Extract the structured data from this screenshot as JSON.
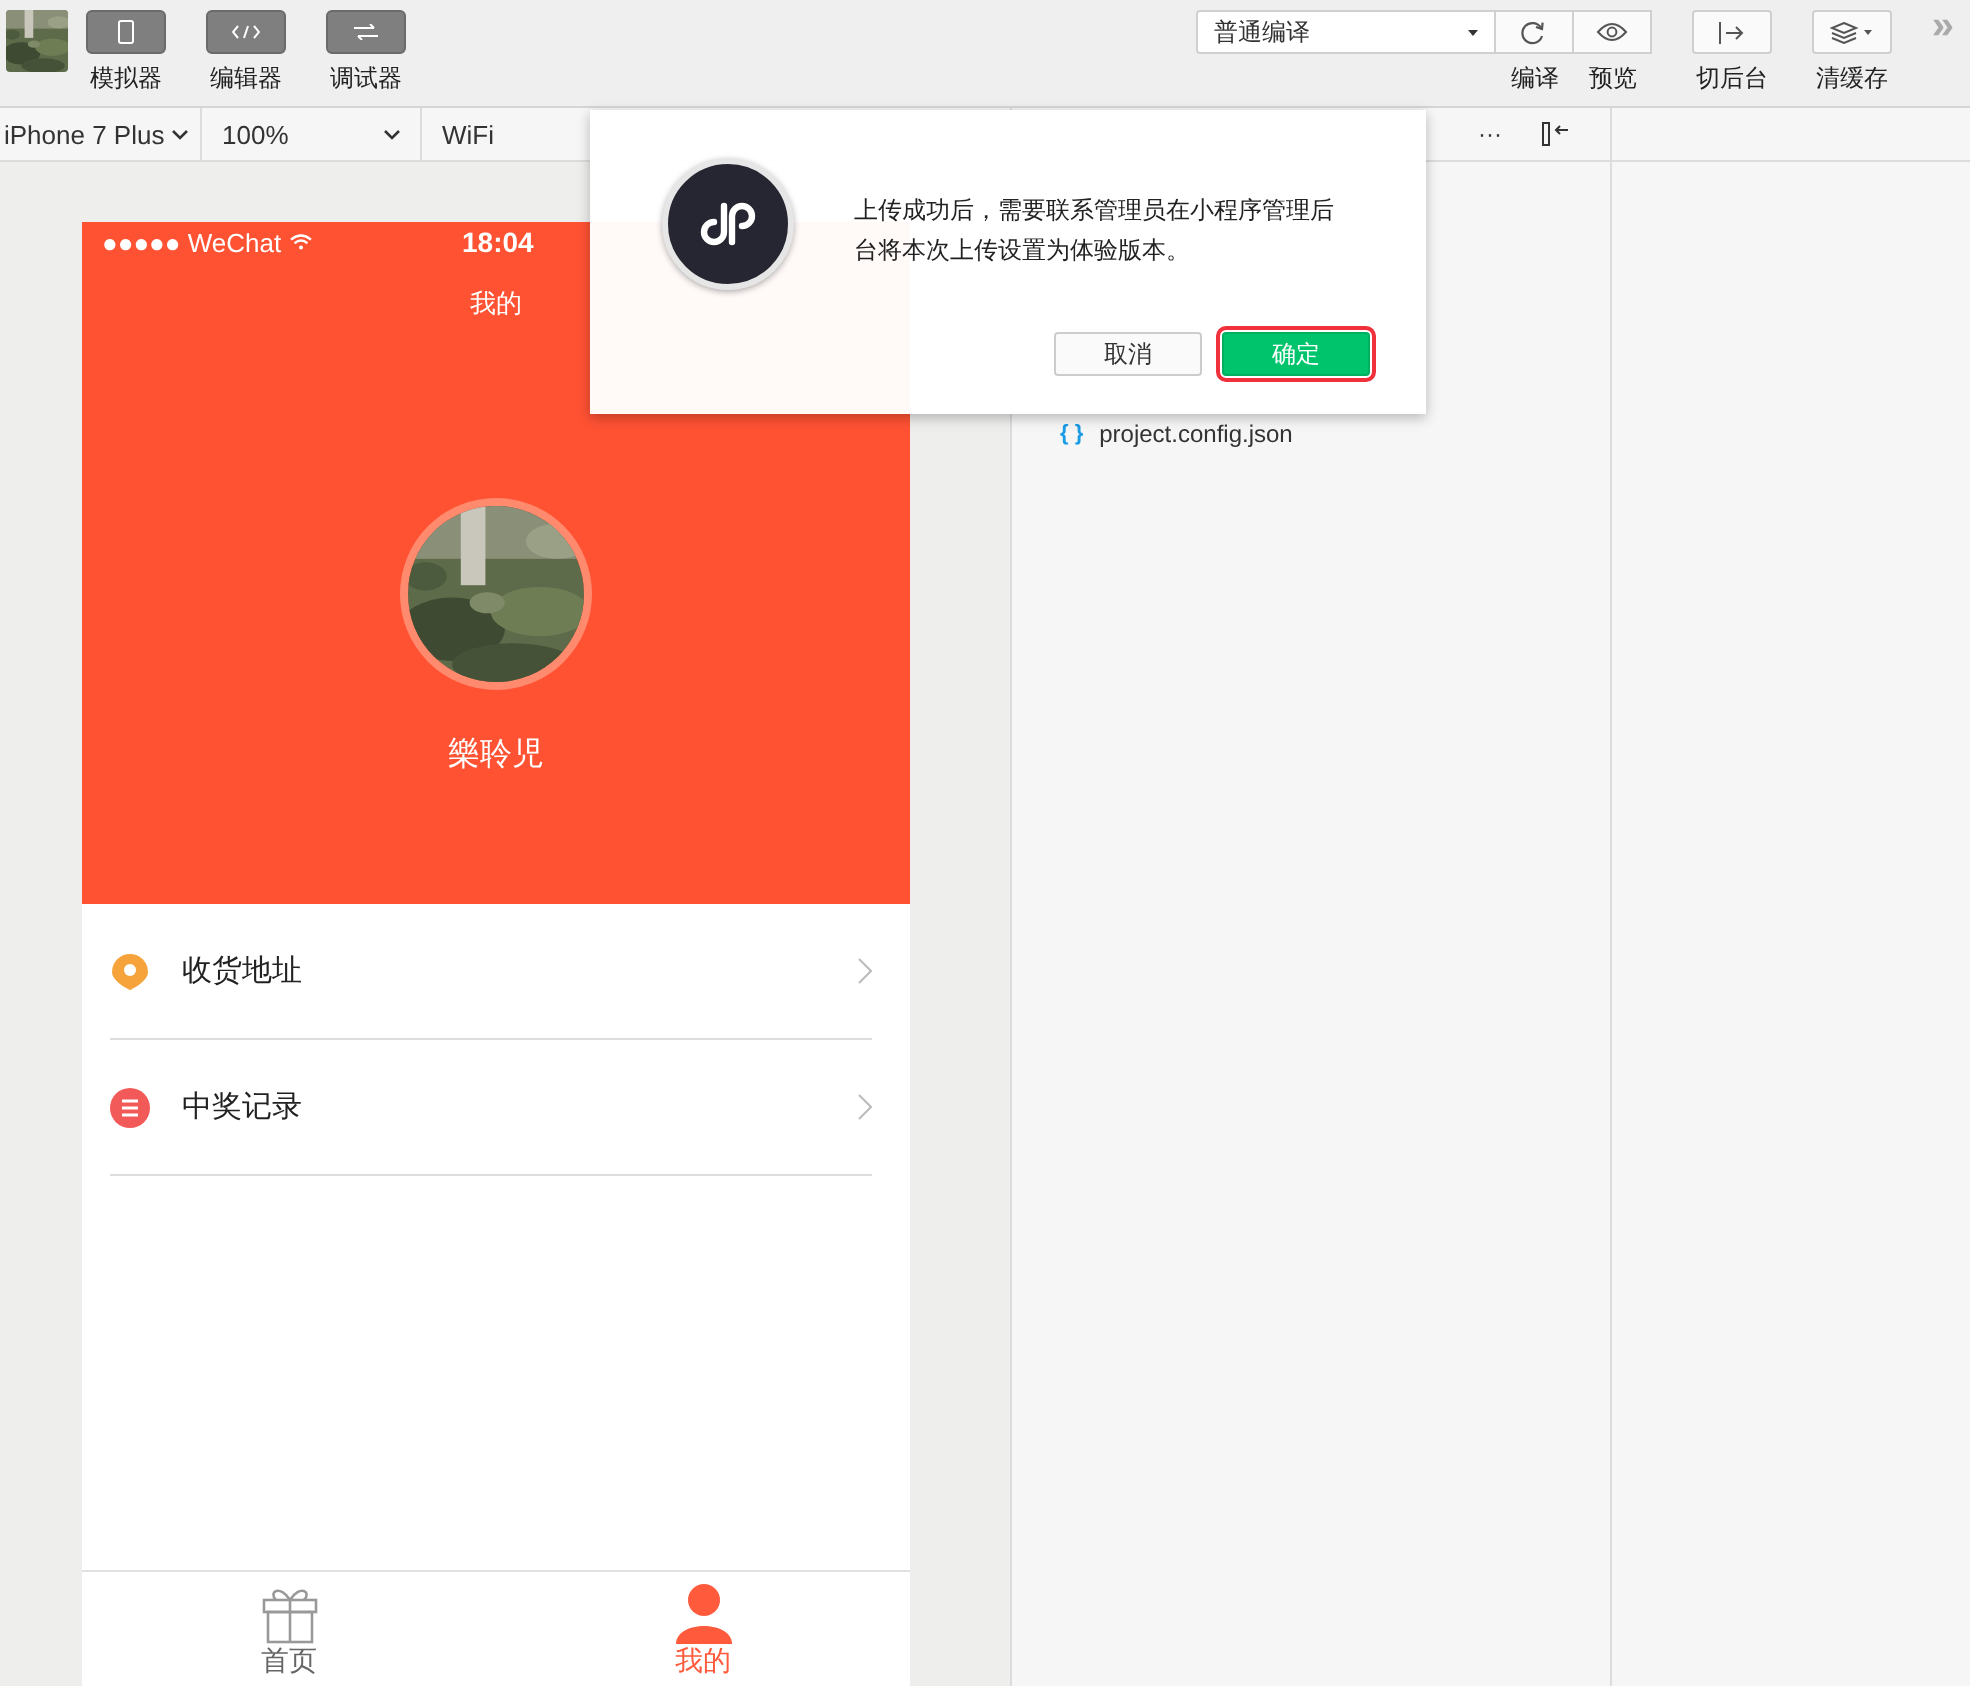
{
  "toolbar": {
    "modes": [
      {
        "kind": "simulator",
        "label": "模拟器"
      },
      {
        "kind": "editor",
        "label": "编辑器"
      },
      {
        "kind": "debugger",
        "label": "调试器"
      }
    ],
    "compile_mode": "普通编译",
    "actions": [
      {
        "kind": "refresh",
        "label": "编译"
      },
      {
        "kind": "eye",
        "label": "预览"
      },
      {
        "kind": "background",
        "label": "切后台"
      },
      {
        "kind": "layers",
        "label": "清缓存"
      }
    ],
    "more": "»"
  },
  "simulator_bar": {
    "device": "iPhone 7 Plus",
    "zoom": "100%",
    "network": "WiFi"
  },
  "editor_bar": {
    "more": "···"
  },
  "files": [
    {
      "kind": "json",
      "icon": "{ }",
      "name": "project.config.json"
    }
  ],
  "phone": {
    "status": {
      "signal": "●●●●●",
      "carrier": "WeChat",
      "time": "18:04"
    },
    "title": "我的",
    "profile": {
      "name": "樂聆児"
    },
    "menu": [
      {
        "kind": "location",
        "label": "收货地址",
        "color": "#f5a33a"
      },
      {
        "kind": "list",
        "label": "中奖记录",
        "color": "#f25a5a"
      }
    ],
    "tabbar": [
      {
        "kind": "gift",
        "label": "首页",
        "selected": false
      },
      {
        "kind": "person",
        "label": "我的",
        "selected": true
      }
    ]
  },
  "dialog": {
    "message": "上传成功后，需要联系管理员在小程序管理后台将本次上传设置为体验版本。",
    "buttons": [
      {
        "kind": "cancel",
        "label": "取消",
        "highlighted": false
      },
      {
        "kind": "confirm",
        "label": "确定",
        "highlighted": true
      }
    ]
  }
}
